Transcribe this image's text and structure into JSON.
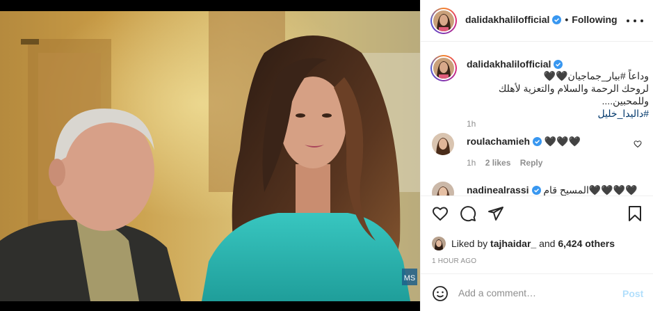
{
  "post": {
    "username": "dalidakhalilofficial",
    "follow_state": "Following",
    "caption_username": "dalidakhalilofficial",
    "caption_line1": "وداعاً #بيار_جماجيان🖤🖤",
    "caption_line2": "لروحك الرحمة والسلام والتعزية لأهلك وللمحبين....",
    "caption_hashtag": "#داليدا_خليل",
    "caption_time": "1h"
  },
  "comments": [
    {
      "username": "roulachamieh",
      "text": "🖤🖤🖤",
      "time": "1h",
      "likes": "2 likes",
      "reply": "Reply"
    },
    {
      "username": "nadinealrassi",
      "text": "المسيح قام🖤🖤🖤🖤"
    }
  ],
  "liked_by": {
    "prefix": "Liked by",
    "user": "tajhaidar_",
    "joiner": "and",
    "others": "6,424 others"
  },
  "time_ago": "1 HOUR AGO",
  "add_comment": {
    "placeholder": "Add a comment…",
    "post_label": "Post"
  },
  "colors": {
    "verified": "#3897f0",
    "link": "#00376b",
    "post_disabled": "#b2dffc",
    "muted": "#8e8e8e"
  },
  "icons": [
    "more-icon",
    "verified-icon",
    "heart-icon",
    "comment-icon",
    "share-icon",
    "save-icon",
    "emoji-icon"
  ]
}
